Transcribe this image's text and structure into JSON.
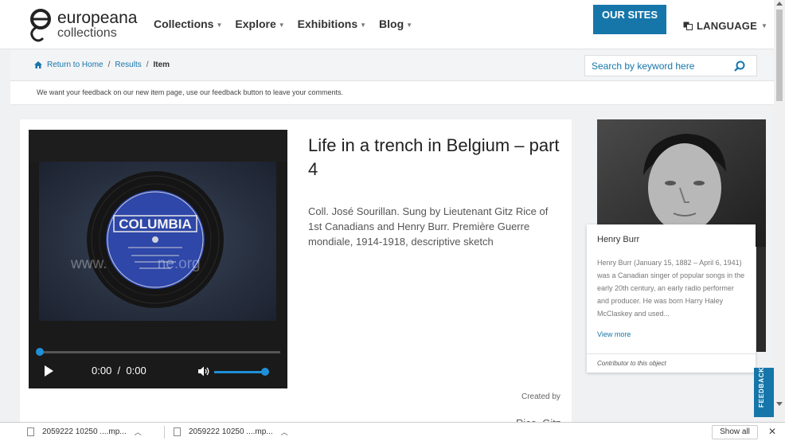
{
  "header": {
    "logo_line1": "europeana",
    "logo_line2": "collections",
    "nav": [
      "Collections",
      "Explore",
      "Exhibitions",
      "Blog"
    ],
    "our_sites": "OUR SITES",
    "language": "LANGUAGE",
    "accent_color": "#1676aa"
  },
  "breadcrumb": {
    "home": "Return to Home",
    "results": "Results",
    "current": "Item",
    "separator": "/"
  },
  "search": {
    "placeholder": "Search by keyword here"
  },
  "notice": "We want your feedback on our new item page, use our feedback button to leave your comments.",
  "player": {
    "current_time": "0:00",
    "duration": "0:00",
    "time_separator": "/",
    "progress": 0,
    "volume": 1.0,
    "label_brand": "COLUMBIA",
    "watermark": "www.            ne.org"
  },
  "item": {
    "title": "Life in a trench in Belgium – part 4",
    "description": "Coll. José Sourillan. Sung by Lieutenant Gitz Rice of 1st Canadians and Henry Burr. Première Guerre mondiale, 1914-1918, descriptive sketch",
    "created_label": "Created by",
    "created_value": "Rice, Gitz"
  },
  "contributor": {
    "name": "Henry Burr",
    "bio": "Henry Burr (January 15, 1882 – April 6, 1941) was a Canadian singer of popular songs in the early 20th century, an early radio performer and producer. He was born Harry Haley McClaskey and used...",
    "view_more": "View more",
    "footer": "Contributor to this object"
  },
  "feedback_tab": "FEEDBACK",
  "downloads": {
    "items": [
      "2059222 10250 ....mp...",
      "2059222 10250 ....mp..."
    ],
    "show_all": "Show all",
    "close": "✕"
  }
}
